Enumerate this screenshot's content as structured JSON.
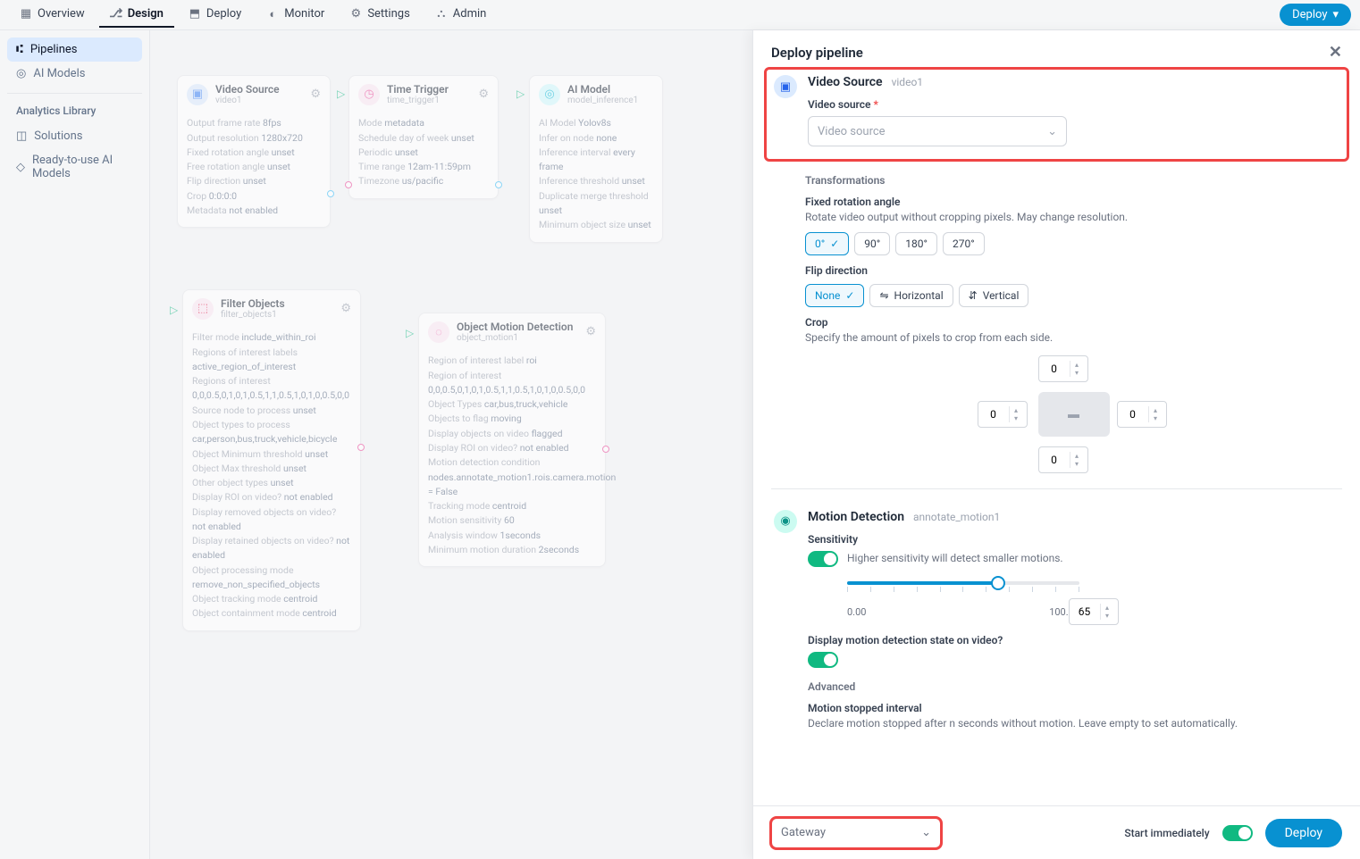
{
  "nav": {
    "items": [
      {
        "label": "Overview"
      },
      {
        "label": "Design"
      },
      {
        "label": "Deploy"
      },
      {
        "label": "Monitor"
      },
      {
        "label": "Settings"
      },
      {
        "label": "Admin"
      }
    ],
    "deploy_btn": "Deploy"
  },
  "sidebar": {
    "items": [
      {
        "label": "Pipelines"
      },
      {
        "label": "AI Models"
      }
    ],
    "lib_header": "Analytics Library",
    "lib_items": [
      {
        "label": "Solutions"
      },
      {
        "label": "Ready-to-use AI Models"
      }
    ]
  },
  "nodes": {
    "video": {
      "title": "Video Source",
      "sub": "video1",
      "rows": [
        [
          "Output frame rate",
          "8fps"
        ],
        [
          "Output resolution",
          "1280x720"
        ],
        [
          "Fixed rotation angle",
          "unset"
        ],
        [
          "Free rotation angle",
          "unset"
        ],
        [
          "Flip direction",
          "unset"
        ],
        [
          "Crop",
          "0:0:0:0"
        ],
        [
          "Metadata",
          "not enabled"
        ]
      ]
    },
    "time": {
      "title": "Time Trigger",
      "sub": "time_trigger1",
      "rows": [
        [
          "Mode",
          "metadata"
        ],
        [
          "Schedule day of week",
          "unset"
        ],
        [
          "Periodic",
          "unset"
        ],
        [
          "Time range",
          "12am-11:59pm"
        ],
        [
          "Timezone",
          "us/pacific"
        ]
      ]
    },
    "ai": {
      "title": "AI Model",
      "sub": "model_inference1",
      "rows": [
        [
          "AI Model",
          "Yolov8s"
        ],
        [
          "Infer on node",
          "none"
        ],
        [
          "Inference interval",
          "every frame"
        ],
        [
          "Inference threshold",
          "unset"
        ],
        [
          "Duplicate merge threshold",
          "unset"
        ],
        [
          "Minimum object size",
          "unset"
        ]
      ]
    },
    "filter": {
      "title": "Filter Objects",
      "sub": "filter_objects1",
      "rows": [
        [
          "Filter mode",
          "include_within_roi"
        ],
        [
          "Regions of interest labels",
          ""
        ],
        [
          "",
          "active_region_of_interest"
        ],
        [
          "Regions of interest",
          ""
        ],
        [
          "",
          "0,0,0.5,0,1,0,1,0.5,1,1,0.5,1,0,1,0,0.5,0,0"
        ],
        [
          "Source node to process",
          "unset"
        ],
        [
          "Object types to process",
          ""
        ],
        [
          "",
          "car,person,bus,truck,vehicle,bicycle"
        ],
        [
          "Object Minimum threshold",
          "unset"
        ],
        [
          "Object Max threshold",
          "unset"
        ],
        [
          "Other object types",
          "unset"
        ],
        [
          "Display ROI on video?",
          "not enabled"
        ],
        [
          "Display removed objects on video?",
          "not enabled"
        ],
        [
          "Display retained objects on video?",
          "not enabled"
        ],
        [
          "Object processing mode",
          ""
        ],
        [
          "",
          "remove_non_specified_objects"
        ],
        [
          "Object tracking mode",
          "centroid"
        ],
        [
          "Object containment mode",
          "centroid"
        ]
      ]
    },
    "motion": {
      "title": "Object Motion Detection",
      "sub": "object_motion1",
      "rows": [
        [
          "Region of interest label",
          "roi"
        ],
        [
          "Region of interest",
          ""
        ],
        [
          "",
          "0,0,0.5,0,1,0,1,0.5,1,1,0.5,1,0,1,0,0.5,0,0"
        ],
        [
          "Object Types",
          "car,bus,truck,vehicle"
        ],
        [
          "Objects to flag",
          "moving"
        ],
        [
          "Display objects on video",
          "flagged"
        ],
        [
          "Display ROI on video?",
          "not enabled"
        ],
        [
          "Motion detection condition",
          ""
        ],
        [
          "",
          "nodes.annotate_motion1.rois.camera.motion = False"
        ],
        [
          "Tracking mode",
          "centroid"
        ],
        [
          "Motion sensitivity",
          "60"
        ],
        [
          "Analysis window",
          "1seconds"
        ],
        [
          "Minimum motion duration",
          "2seconds"
        ]
      ]
    }
  },
  "panel": {
    "title": "Deploy pipeline",
    "s1": {
      "title": "Video Source",
      "sub": "video1",
      "field_label": "Video source",
      "select_placeholder": "Video source"
    },
    "transforms_header": "Transformations",
    "rot": {
      "label": "Fixed rotation angle",
      "desc": "Rotate video output without cropping pixels. May change resolution.",
      "opts": [
        "0°",
        "90°",
        "180°",
        "270°"
      ]
    },
    "flip": {
      "label": "Flip direction",
      "opts": [
        "None",
        "Horizontal",
        "Vertical"
      ]
    },
    "crop": {
      "label": "Crop",
      "desc": "Specify the amount of pixels to crop from each side.",
      "top": "0",
      "left": "0",
      "right": "0",
      "bottom": "0"
    },
    "s2": {
      "title": "Motion Detection",
      "sub": "annotate_motion1",
      "sens_label": "Sensitivity",
      "sens_desc": "Higher sensitivity will detect smaller motions.",
      "sens_min": "0.00",
      "sens_max": "100.00",
      "sens_val": "65",
      "disp_label": "Display motion detection state on video?",
      "adv_label": "Advanced",
      "msi_label": "Motion stopped interval",
      "msi_desc": "Declare motion stopped after n seconds without motion. Leave empty to set automatically."
    },
    "footer": {
      "gateway": "Gateway",
      "start": "Start immediately",
      "deploy": "Deploy"
    }
  }
}
